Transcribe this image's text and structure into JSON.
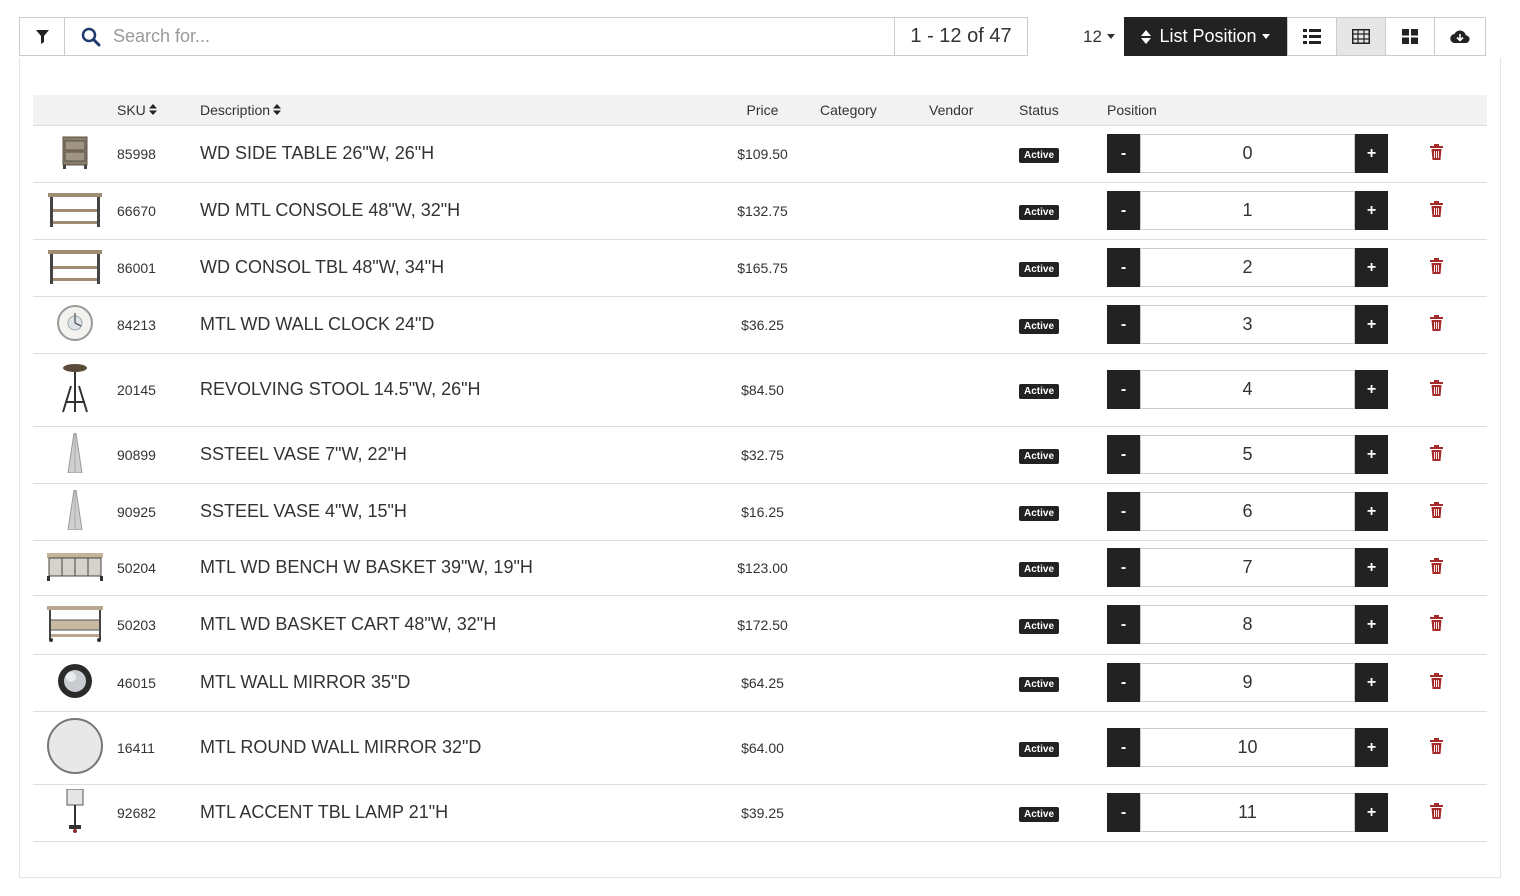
{
  "toolbar": {
    "search_placeholder": "Search for...",
    "pager": "1 - 12 of 47",
    "per_page": "12",
    "sort_label": "List Position"
  },
  "table": {
    "headers": {
      "sku": "SKU",
      "description": "Description",
      "price": "Price",
      "category": "Category",
      "vendor": "Vendor",
      "status": "Status",
      "position": "Position"
    },
    "rows": [
      {
        "sku": "85998",
        "description": "WD SIDE TABLE 26\"W, 26\"H",
        "price": "$109.50",
        "status": "Active",
        "position": "0",
        "image": "side-table"
      },
      {
        "sku": "66670",
        "description": "WD MTL CONSOLE 48\"W, 32\"H",
        "price": "$132.75",
        "status": "Active",
        "position": "1",
        "image": "console"
      },
      {
        "sku": "86001",
        "description": "WD CONSOL TBL 48\"W, 34\"H",
        "price": "$165.75",
        "status": "Active",
        "position": "2",
        "image": "console"
      },
      {
        "sku": "84213",
        "description": "MTL WD WALL CLOCK 24\"D",
        "price": "$36.25",
        "status": "Active",
        "position": "3",
        "image": "clock"
      },
      {
        "sku": "20145",
        "description": "REVOLVING STOOL 14.5\"W, 26\"H",
        "price": "$84.50",
        "status": "Active",
        "position": "4",
        "image": "stool"
      },
      {
        "sku": "90899",
        "description": "SSTEEL VASE 7\"W, 22\"H",
        "price": "$32.75",
        "status": "Active",
        "position": "5",
        "image": "vase"
      },
      {
        "sku": "90925",
        "description": "SSTEEL VASE 4\"W, 15\"H",
        "price": "$16.25",
        "status": "Active",
        "position": "6",
        "image": "vase"
      },
      {
        "sku": "50204",
        "description": "MTL WD BENCH W BASKET 39\"W, 19\"H",
        "price": "$123.00",
        "status": "Active",
        "position": "7",
        "image": "bench"
      },
      {
        "sku": "50203",
        "description": "MTL WD BASKET CART 48\"W, 32\"H",
        "price": "$172.50",
        "status": "Active",
        "position": "8",
        "image": "cart"
      },
      {
        "sku": "46015",
        "description": "MTL WALL MIRROR 35\"D",
        "price": "$64.25",
        "status": "Active",
        "position": "9",
        "image": "mirror-dark"
      },
      {
        "sku": "16411",
        "description": "MTL ROUND WALL MIRROR 32\"D",
        "price": "$64.00",
        "status": "Active",
        "position": "10",
        "image": "mirror-round"
      },
      {
        "sku": "92682",
        "description": "MTL ACCENT TBL LAMP 21\"H",
        "price": "$39.25",
        "status": "Active",
        "position": "11",
        "image": "lamp"
      }
    ]
  },
  "row_heights": [
    57,
    57,
    57,
    57,
    73,
    57,
    57,
    55,
    59,
    57,
    73,
    57
  ],
  "colors": {
    "accent": "#222222",
    "delete": "#a52a2a",
    "header_bg": "#f2f2f2"
  }
}
